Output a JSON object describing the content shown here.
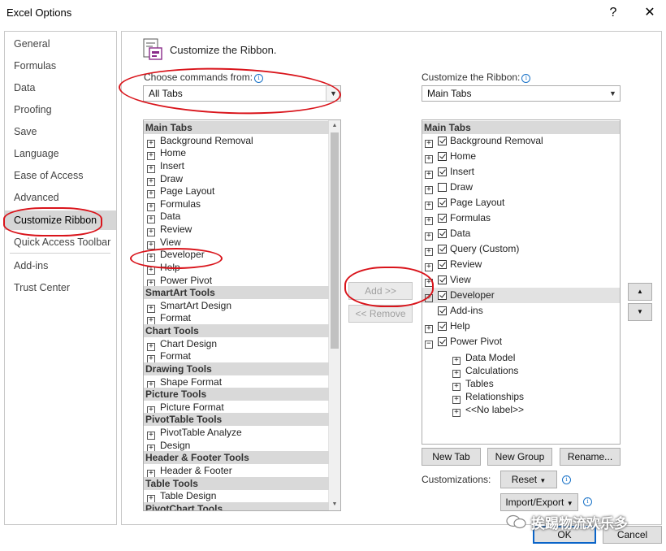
{
  "window": {
    "title": "Excel Options",
    "help_glyph": "?",
    "close_glyph": "✕"
  },
  "nav": {
    "items": [
      "General",
      "Formulas",
      "Data",
      "Proofing",
      "Save",
      "Language",
      "Ease of Access",
      "Advanced",
      "Customize Ribbon",
      "Quick Access Toolbar",
      "Add-ins",
      "Trust Center"
    ],
    "selected": "Customize Ribbon"
  },
  "header": {
    "title": "Customize the Ribbon."
  },
  "left": {
    "label": "Choose commands from:",
    "combo_value": "All Tabs",
    "rows": [
      {
        "t": "h",
        "l": "Main Tabs"
      },
      {
        "t": "i",
        "l": "Background Removal"
      },
      {
        "t": "i",
        "l": "Home"
      },
      {
        "t": "i",
        "l": "Insert"
      },
      {
        "t": "i",
        "l": "Draw"
      },
      {
        "t": "i",
        "l": "Page Layout"
      },
      {
        "t": "i",
        "l": "Formulas"
      },
      {
        "t": "i",
        "l": "Data"
      },
      {
        "t": "i",
        "l": "Review"
      },
      {
        "t": "i",
        "l": "View"
      },
      {
        "t": "i",
        "l": "Developer"
      },
      {
        "t": "i",
        "l": "Help"
      },
      {
        "t": "i",
        "l": "Power Pivot"
      },
      {
        "t": "h",
        "l": "SmartArt Tools"
      },
      {
        "t": "i",
        "l": "SmartArt Design"
      },
      {
        "t": "i",
        "l": "Format"
      },
      {
        "t": "h",
        "l": "Chart Tools"
      },
      {
        "t": "i",
        "l": "Chart Design"
      },
      {
        "t": "i",
        "l": "Format"
      },
      {
        "t": "h",
        "l": "Drawing Tools"
      },
      {
        "t": "i",
        "l": "Shape Format"
      },
      {
        "t": "h",
        "l": "Picture Tools"
      },
      {
        "t": "i",
        "l": "Picture Format"
      },
      {
        "t": "h",
        "l": "PivotTable Tools"
      },
      {
        "t": "i",
        "l": "PivotTable Analyze"
      },
      {
        "t": "i",
        "l": "Design"
      },
      {
        "t": "h",
        "l": "Header & Footer Tools"
      },
      {
        "t": "i",
        "l": "Header & Footer"
      },
      {
        "t": "h",
        "l": "Table Tools"
      },
      {
        "t": "i",
        "l": "Table Design"
      },
      {
        "t": "h",
        "l": "PivotChart Tools"
      }
    ]
  },
  "middle": {
    "add_label": "Add >>",
    "remove_label": "<< Remove"
  },
  "right": {
    "label": "Customize the Ribbon:",
    "combo_value": "Main Tabs",
    "header": "Main Tabs",
    "rows": [
      {
        "l": "Background Removal",
        "c": true,
        "e": "+"
      },
      {
        "l": "Home",
        "c": true,
        "e": "+"
      },
      {
        "l": "Insert",
        "c": true,
        "e": "+"
      },
      {
        "l": "Draw",
        "c": false,
        "e": "+"
      },
      {
        "l": "Page Layout",
        "c": true,
        "e": "+"
      },
      {
        "l": "Formulas",
        "c": true,
        "e": "+"
      },
      {
        "l": "Data",
        "c": true,
        "e": "+"
      },
      {
        "l": "Query (Custom)",
        "c": true,
        "e": "+"
      },
      {
        "l": "Review",
        "c": true,
        "e": "+"
      },
      {
        "l": "View",
        "c": true,
        "e": "+"
      },
      {
        "l": "Developer",
        "c": true,
        "e": "+",
        "sel": true
      },
      {
        "l": "Add-ins",
        "c": true,
        "e": ""
      },
      {
        "l": "Help",
        "c": true,
        "e": "+"
      },
      {
        "l": "Power Pivot",
        "c": true,
        "e": "−"
      }
    ],
    "subrows": [
      "Data Model",
      "Calculations",
      "Tables",
      "Relationships",
      "<<No label>>"
    ],
    "move_up": "▲",
    "move_down": "▼"
  },
  "buttons": {
    "new_tab": "New Tab",
    "new_group": "New Group",
    "rename": "Rename...",
    "customizations_label": "Customizations:",
    "reset": "Reset",
    "import_export": "Import/Export",
    "ok": "OK",
    "cancel": "Cancel"
  },
  "watermark": "挨踢物流欢乐多",
  "colors": {
    "annotation": "#d9141b",
    "selected": "#d6d6d6",
    "default_border": "#0a64c8"
  }
}
